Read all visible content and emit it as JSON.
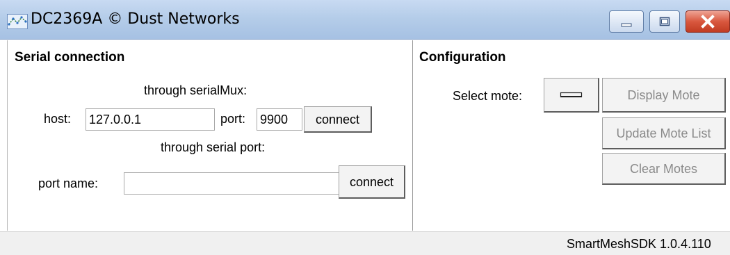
{
  "window": {
    "title": "DC2369A © Dust Networks",
    "colors": {
      "titlebar": "#b5cde9",
      "close_button": "#d9583f"
    }
  },
  "serial_connection": {
    "title": "Serial connection",
    "serialmux_caption": "through serialMux:",
    "host_label": "host:",
    "host_value": "127.0.0.1",
    "port_label": "port:",
    "port_value": "9900",
    "mux_connect_label": "connect",
    "serial_port_caption": "through serial port:",
    "port_name_label": "port name:",
    "port_name_value": "",
    "serial_connect_label": "connect"
  },
  "configuration": {
    "title": "Configuration",
    "select_mote_label": "Select mote:",
    "display_mote_label": "Display Mote",
    "update_mote_list_label": "Update Mote List",
    "clear_motes_label": "Clear Motes"
  },
  "status_bar": {
    "version": "SmartMeshSDK 1.0.4.110"
  },
  "icons": [
    "app-network-icon",
    "minimize-icon",
    "maximize-icon",
    "close-icon",
    "dropdown-indicator-icon"
  ]
}
